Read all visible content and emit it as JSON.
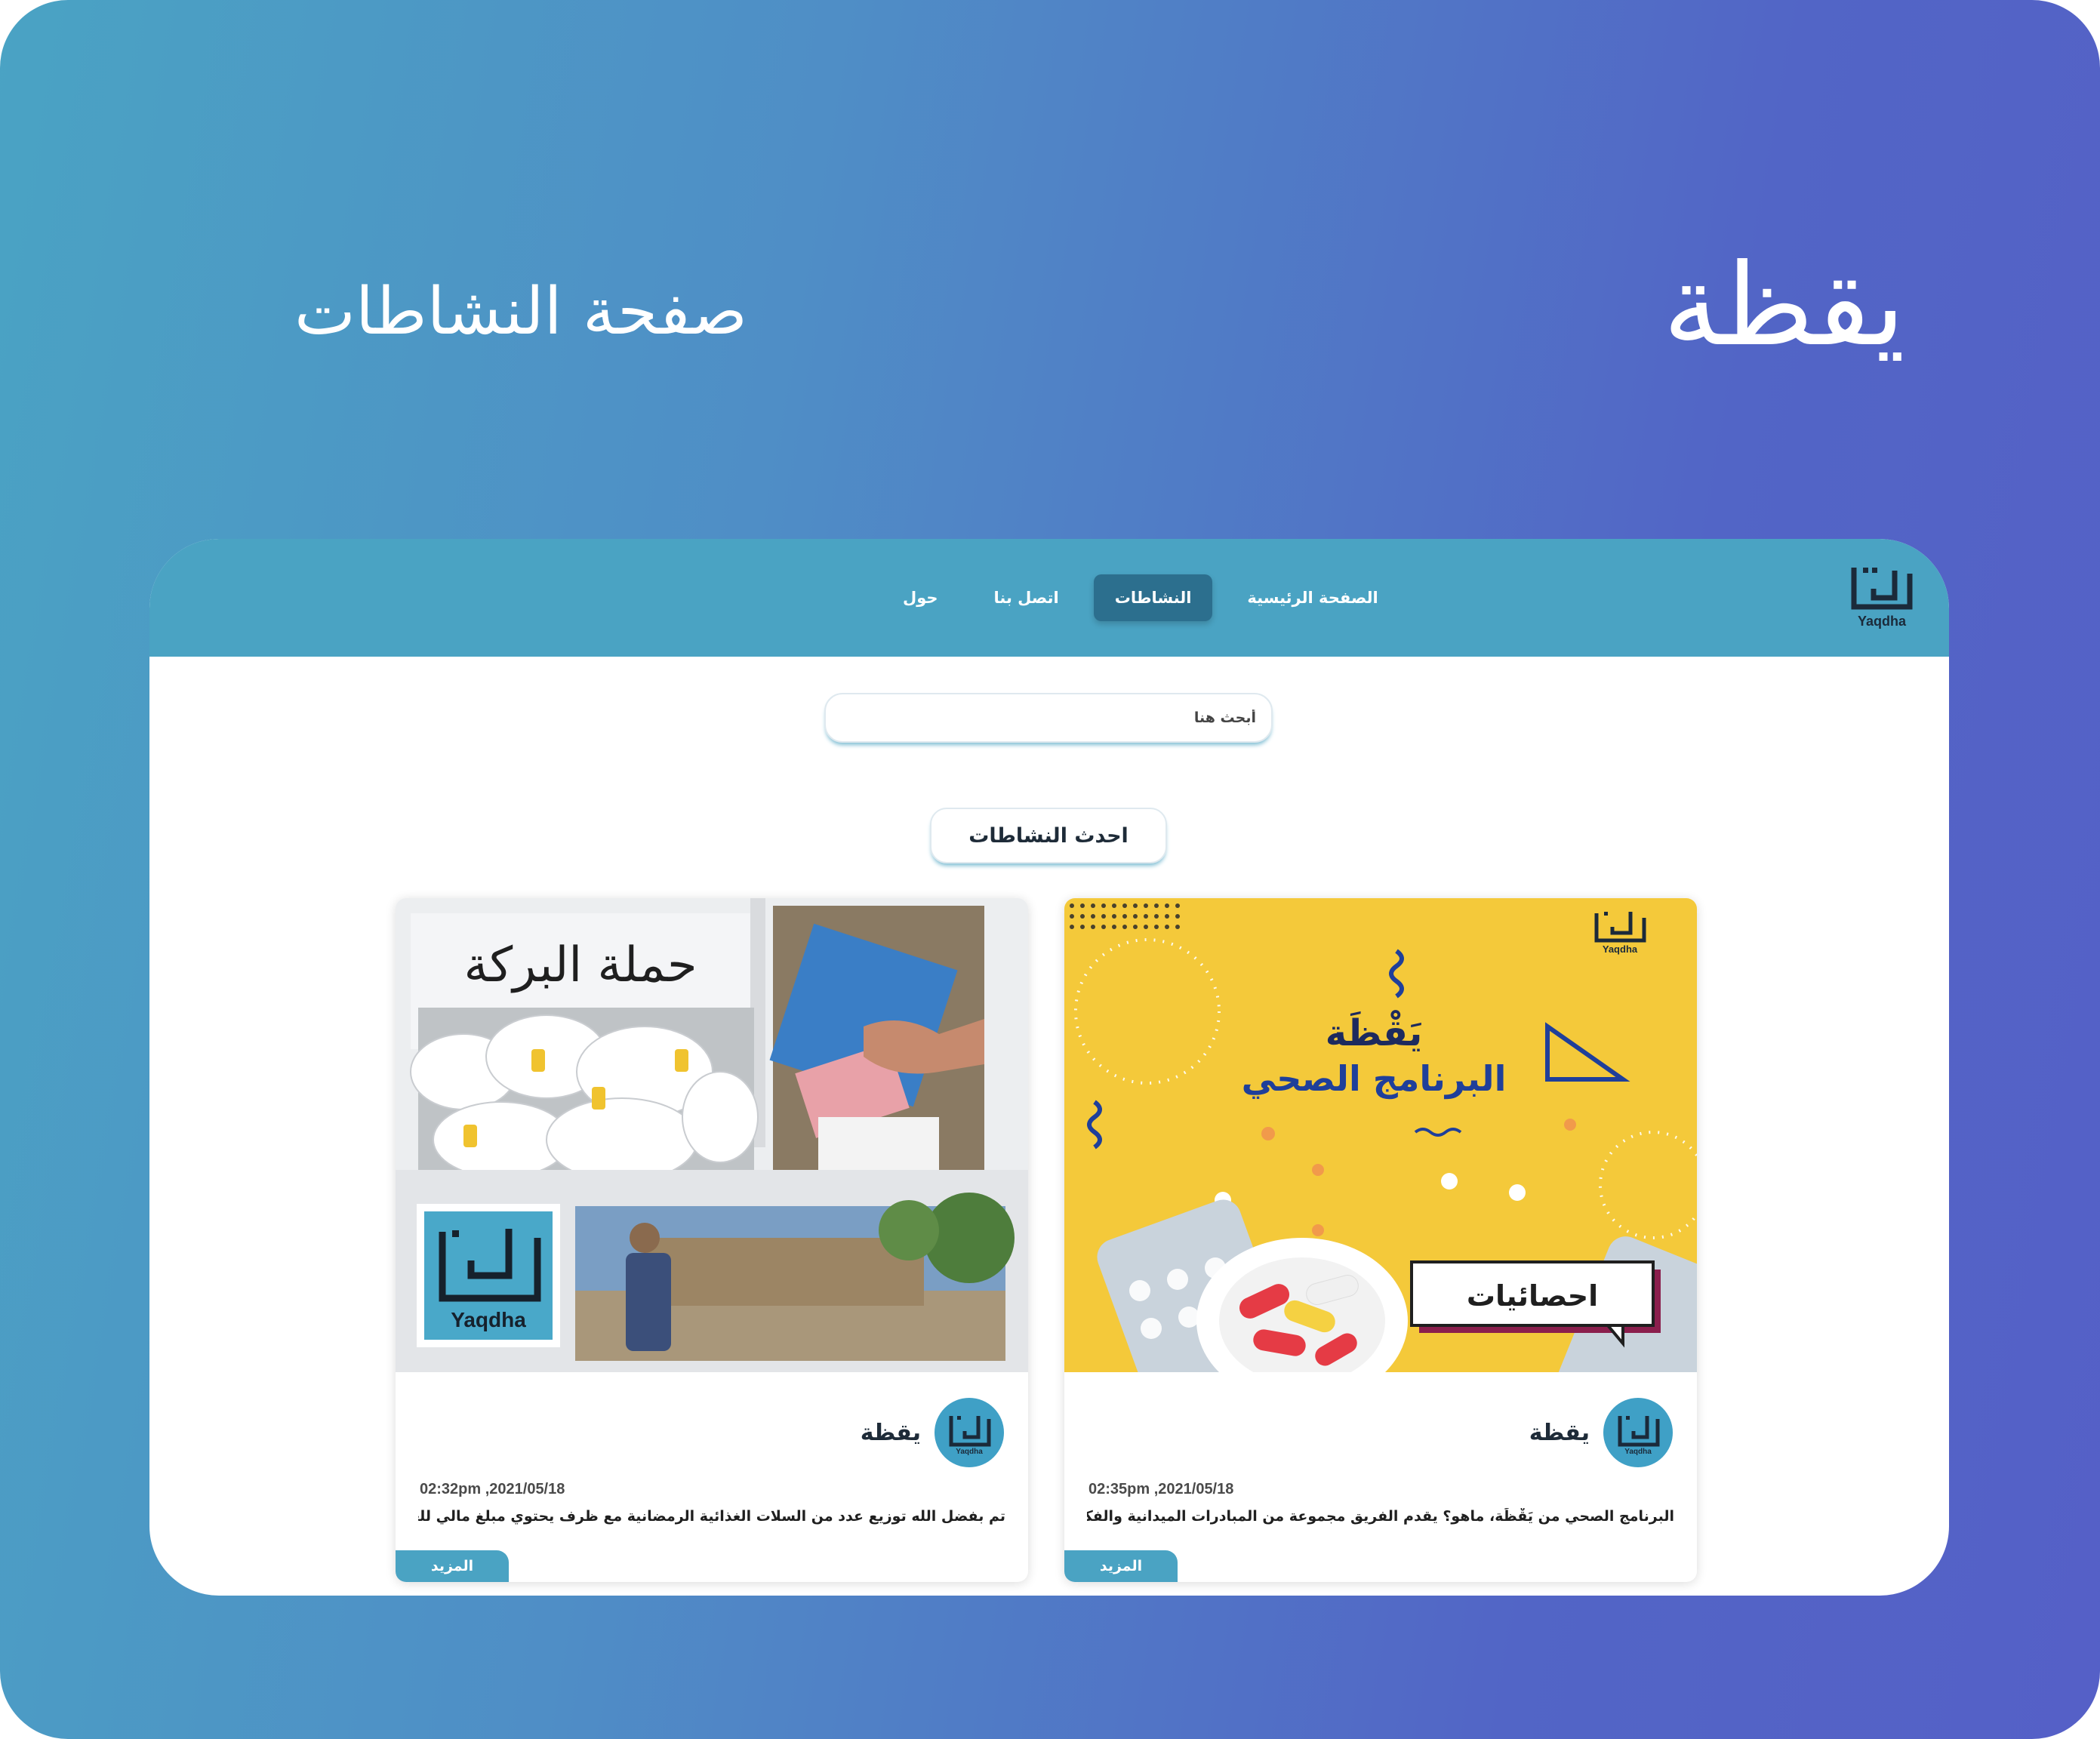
{
  "hero": {
    "brand_title": "يقظة",
    "page_subtitle": "صفحة النشاطات"
  },
  "navbar": {
    "logo_text": "Yaqdha",
    "items": [
      {
        "label": "الصفحة الرئيسية",
        "active": false
      },
      {
        "label": "النشاطات",
        "active": true
      },
      {
        "label": "اتصل بنا",
        "active": false
      },
      {
        "label": "حول",
        "active": false
      }
    ]
  },
  "search": {
    "placeholder": "أبحث هنا"
  },
  "section": {
    "title": "احدث النشاطات"
  },
  "cards": [
    {
      "image": {
        "heading_line1": "يَقْظَة",
        "heading_line2": "البرنامج الصحي",
        "badge": "احصائيات",
        "logo_text": "Yaqdha"
      },
      "author": "يقظة",
      "avatar_text": "Yaqdha",
      "time": "02:35pm ,2021/05/18",
      "text": "البرنامج الصحي من يَقْظَة، ماهو؟ يقدم الفريق مجموعة من المبادرات الميدانية والفكرية هدف..",
      "more_label": "المزيد"
    },
    {
      "image": {
        "heading": "حملة البركة",
        "logo_text": "Yaqdha"
      },
      "author": "يقظة",
      "avatar_text": "Yaqdha",
      "time": "02:32pm ,2021/05/18",
      "text": "تم بفضل الله توزيع عدد من السلات الغذائية الرمضانية مع ظرف يحتوي مبلغ مالي للعوائل ال..",
      "more_label": "المزيد"
    }
  ],
  "colors": {
    "navbar": "#4aa3c3",
    "nav_active": "#2c6f8e",
    "accent": "#4aa3c3",
    "gradient_start": "#4aa3c4",
    "gradient_end": "#5560c7",
    "yellow_bg": "#f4c93a"
  }
}
